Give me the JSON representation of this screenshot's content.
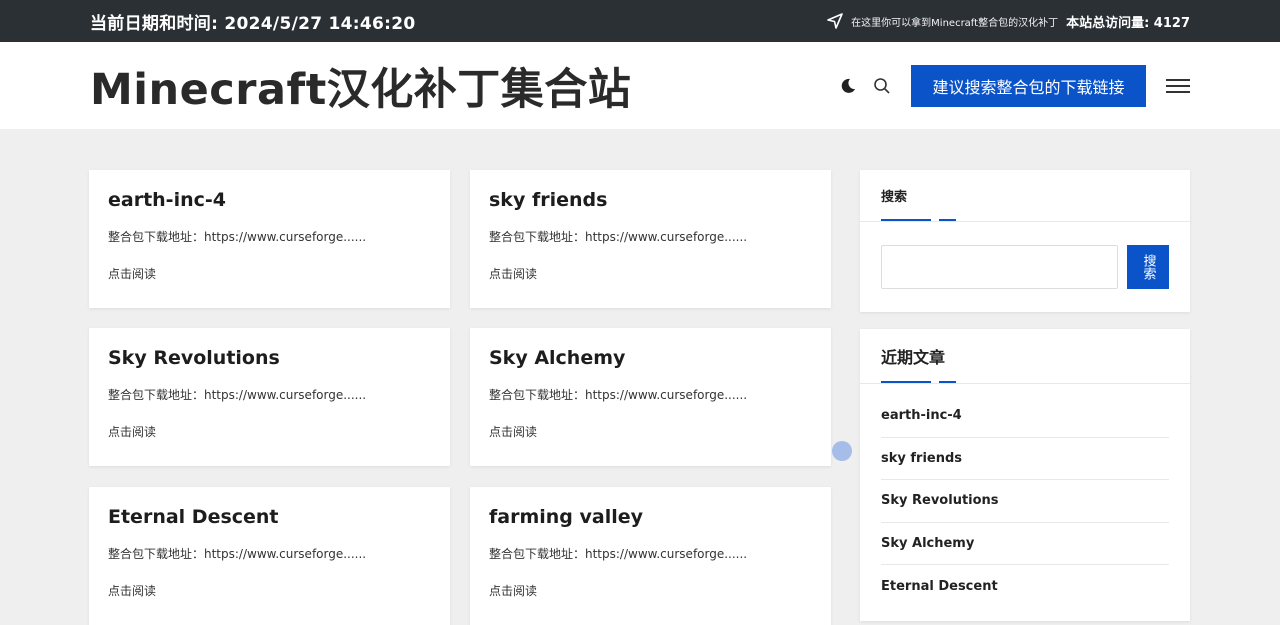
{
  "topbar": {
    "datetime": "当前日期和时间: 2024/5/27 14:46:20",
    "notice": "在这里你可以拿到Minecraft整合包的汉化补丁",
    "visits": "本站总访问量: 4127"
  },
  "header": {
    "site_title": "Minecraft汉化补丁集合站",
    "suggest_button": "建议搜索整合包的下载链接"
  },
  "posts": [
    {
      "title": "earth-inc-4",
      "excerpt": "整合包下载地址：https://www.curseforge......",
      "read_more": "点击阅读"
    },
    {
      "title": "sky friends",
      "excerpt": "整合包下载地址：https://www.curseforge......",
      "read_more": "点击阅读"
    },
    {
      "title": "Sky Revolutions",
      "excerpt": "整合包下载地址：https://www.curseforge......",
      "read_more": "点击阅读"
    },
    {
      "title": "Sky Alchemy",
      "excerpt": "整合包下载地址：https://www.curseforge......",
      "read_more": "点击阅读"
    },
    {
      "title": "Eternal Descent",
      "excerpt": "整合包下载地址：https://www.curseforge......",
      "read_more": "点击阅读"
    },
    {
      "title": "farming valley",
      "excerpt": "整合包下载地址：https://www.curseforge......",
      "read_more": "点击阅读"
    }
  ],
  "sidebar": {
    "search": {
      "title": "搜索",
      "input_value": "",
      "button_label": "搜索"
    },
    "recent": {
      "title": "近期文章",
      "items": [
        "earth-inc-4",
        "sky friends",
        "Sky Revolutions",
        "Sky Alchemy",
        "Eternal Descent"
      ]
    }
  },
  "colors": {
    "accent": "#0a53c9",
    "topbar_bg": "#2b3035",
    "page_bg": "#efefef"
  },
  "icons": [
    "navigation-arrow-icon",
    "moon-icon",
    "search-icon",
    "hamburger-menu-icon"
  ]
}
